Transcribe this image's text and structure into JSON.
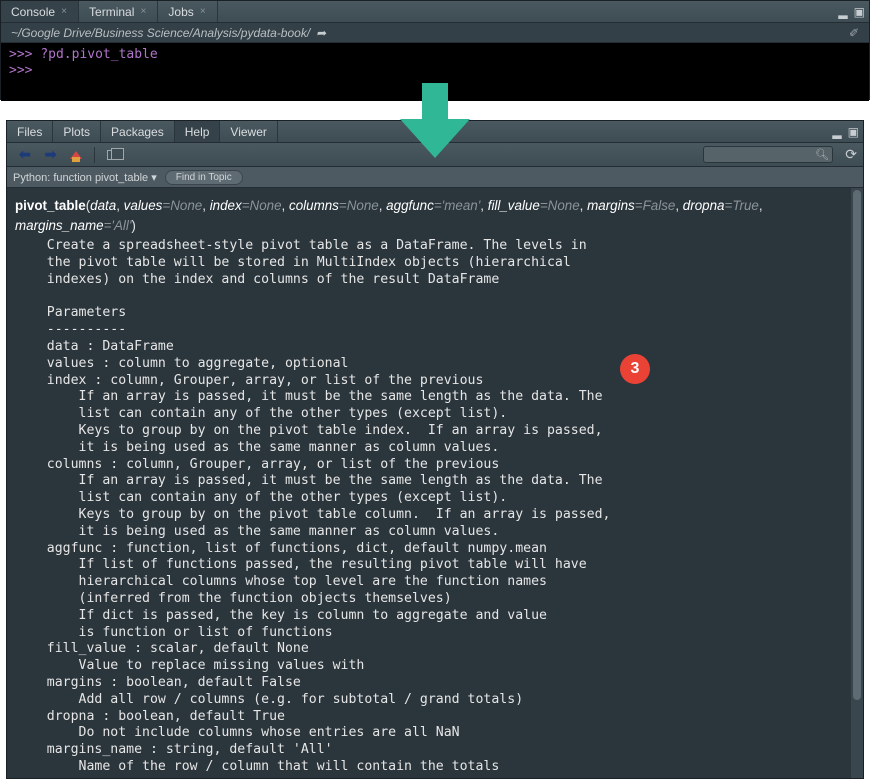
{
  "console": {
    "tabs": [
      {
        "label": "Console",
        "close": true,
        "active": true
      },
      {
        "label": "Terminal",
        "close": true,
        "active": false
      },
      {
        "label": "Jobs",
        "close": true,
        "active": false
      }
    ],
    "path": "~/Google Drive/Business Science/Analysis/pydata-book/",
    "lines": [
      {
        "prompt": ">>>",
        "text": "?pd.pivot_table"
      },
      {
        "prompt": ">>>",
        "text": ""
      }
    ]
  },
  "help_panel": {
    "tabs": [
      {
        "label": "Files",
        "active": false
      },
      {
        "label": "Plots",
        "active": false
      },
      {
        "label": "Packages",
        "active": false
      },
      {
        "label": "Help",
        "active": true
      },
      {
        "label": "Viewer",
        "active": false
      }
    ],
    "topic_dropdown": "Python: function pivot_table",
    "find_in_topic_label": "Find in Topic",
    "search_placeholder": "",
    "signature": {
      "name": "pivot_table",
      "params": [
        {
          "name": "data",
          "default": null
        },
        {
          "name": "values",
          "default": "None"
        },
        {
          "name": "index",
          "default": "None"
        },
        {
          "name": "columns",
          "default": "None"
        },
        {
          "name": "aggfunc",
          "default": "'mean'"
        },
        {
          "name": "fill_value",
          "default": "None"
        },
        {
          "name": "margins",
          "default": "False"
        },
        {
          "name": "dropna",
          "default": "True"
        },
        {
          "name": "margins_name",
          "default": "'All'"
        }
      ]
    },
    "docstring": "    Create a spreadsheet-style pivot table as a DataFrame. The levels in\n    the pivot table will be stored in MultiIndex objects (hierarchical\n    indexes) on the index and columns of the result DataFrame\n\n    Parameters\n    ----------\n    data : DataFrame\n    values : column to aggregate, optional\n    index : column, Grouper, array, or list of the previous\n        If an array is passed, it must be the same length as the data. The\n        list can contain any of the other types (except list).\n        Keys to group by on the pivot table index.  If an array is passed,\n        it is being used as the same manner as column values.\n    columns : column, Grouper, array, or list of the previous\n        If an array is passed, it must be the same length as the data. The\n        list can contain any of the other types (except list).\n        Keys to group by on the pivot table column.  If an array is passed,\n        it is being used as the same manner as column values.\n    aggfunc : function, list of functions, dict, default numpy.mean\n        If list of functions passed, the resulting pivot table will have\n        hierarchical columns whose top level are the function names\n        (inferred from the function objects themselves)\n        If dict is passed, the key is column to aggregate and value\n        is function or list of functions\n    fill_value : scalar, default None\n        Value to replace missing values with\n    margins : boolean, default False\n        Add all row / columns (e.g. for subtotal / grand totals)\n    dropna : boolean, default True\n        Do not include columns whose entries are all NaN\n    margins_name : string, default 'All'\n        Name of the row / column that will contain the totals"
  },
  "badge": {
    "number": "3"
  },
  "colors": {
    "arrow": "#2fb796",
    "badge": "#ea4335"
  }
}
